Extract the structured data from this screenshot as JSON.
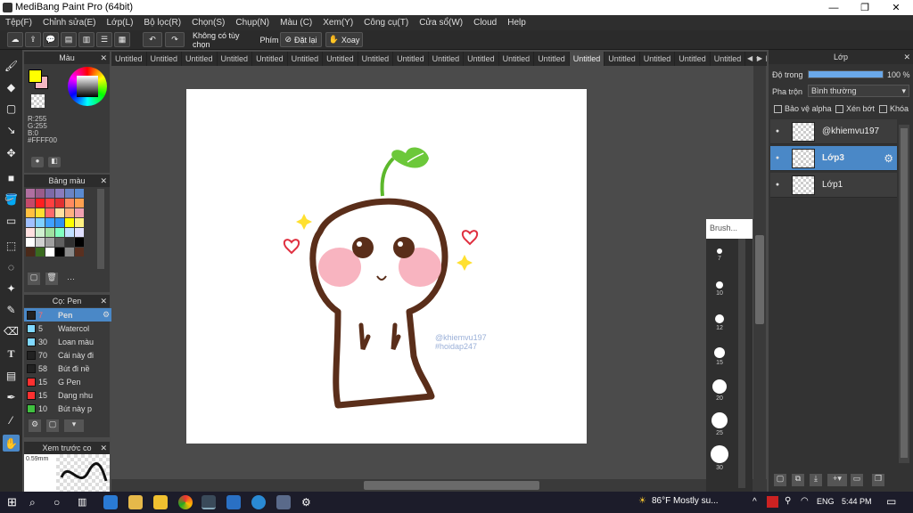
{
  "app": {
    "title": "MediBang Paint Pro (64bit)"
  },
  "window_controls": {
    "minimize": "—",
    "maximize": "❐",
    "close": "✕"
  },
  "menu": [
    "Tệp(F)",
    "Chỉnh sửa(E)",
    "Lớp(L)",
    "Bộ lọc(R)",
    "Chọn(S)",
    "Chụp(N)",
    "Màu (C)",
    "Xem(Y)",
    "Công cụ(T)",
    "Cửa sổ(W)",
    "Cloud",
    "Help"
  ],
  "toolbar": {
    "selection_label": "Không có tùy chọn",
    "keys_label": "Phím",
    "reset_label": "Đặt lại",
    "rotate_label": "Xoay"
  },
  "color_panel": {
    "title": "Màu",
    "r": "R:255",
    "g": "G:255",
    "b": "B:0",
    "hex": "#FFFF00",
    "primary": "#FFFF00",
    "secondary": "#F4B6C2"
  },
  "palette_panel": {
    "title": "Bảng màu",
    "more": "···",
    "colors": [
      "#b06fa0",
      "#9a5c8a",
      "#7d6aa8",
      "#8a7cbd",
      "#6a84c4",
      "#5a8ad0",
      "#c44a6a",
      "#ff2020",
      "#ff4040",
      "#e03030",
      "#ff8a60",
      "#ffa050",
      "#ffc040",
      "#ffe030",
      "#ff6a6a",
      "#ffe0a0",
      "#ffb080",
      "#f0a0b0",
      "#a0c0ff",
      "#80d0ff",
      "#40a0ff",
      "#3090f0",
      "#ffff00",
      "#fff080",
      "#ffe0e0",
      "#d0f0d0",
      "#a0e0a0",
      "#80ffc0",
      "#c0e0ff",
      "#e0e0ff",
      "#ffffff",
      "#d0d0d0",
      "#a0a0a0",
      "#606060",
      "#303030",
      "#000000",
      "#4a2a1a",
      "#3a6a20",
      "#ffffff",
      "#000000",
      "#8a8a8a",
      "#5a3020"
    ]
  },
  "brush_panel": {
    "title": "Cọ: Pen",
    "items": [
      {
        "size": "7",
        "name": "Pen",
        "color": "#222222",
        "selected": true
      },
      {
        "size": "5",
        "name": "Watercol",
        "color": "#80d8ff"
      },
      {
        "size": "30",
        "name": "Loan màu",
        "color": "#80d8ff"
      },
      {
        "size": "70",
        "name": "Cái này đi",
        "color": "#222222"
      },
      {
        "size": "58",
        "name": "Bút đi nề",
        "color": "#222222"
      },
      {
        "size": "15",
        "name": "G Pen",
        "color": "#ff3030"
      },
      {
        "size": "15",
        "name": "Dạng nhu",
        "color": "#ff3030"
      },
      {
        "size": "10",
        "name": "Bút này p",
        "color": "#40c040"
      }
    ]
  },
  "preview_panel": {
    "title": "Xem trước co",
    "size": "0.59mm"
  },
  "tabs": {
    "items": [
      "Untitled",
      "Untitled",
      "Untitled",
      "Untitled",
      "Untitled",
      "Untitled",
      "Untitled",
      "Untitled",
      "Untitled",
      "Untitled",
      "Untitled",
      "Untitled",
      "Untitled",
      "Untitled",
      "Untitled",
      "Untitled",
      "Untitled",
      "Untitled",
      "Untitled",
      "Untitled"
    ],
    "active_index": 13
  },
  "brush_size": {
    "title": "Brush...",
    "sizes": [
      "7",
      "10",
      "12",
      "15",
      "20",
      "25",
      "30"
    ]
  },
  "layer_panel": {
    "title": "Lớp",
    "opacity_label": "Độ trong",
    "opacity_value": "100 %",
    "opacity": 1.0,
    "blend_label": "Pha trộn",
    "blend_value": "Bình thường",
    "protect_alpha": "Bảo vệ alpha",
    "clipping": "Xén bớt",
    "lock": "Khóa",
    "layers": [
      {
        "name": "@khiemvu197",
        "selected": false
      },
      {
        "name": "Lớp3",
        "selected": true
      },
      {
        "name": "Lớp1",
        "selected": false
      }
    ]
  },
  "canvas": {
    "watermark1": "@khiemvu197",
    "watermark2": "#hoidap247"
  },
  "taskbar": {
    "weather": "86°F  Mostly su...",
    "lang": "ENG",
    "time": "5:44 PM"
  },
  "colors": {
    "accent": "#4a88c7",
    "bg": "#4a4a4a"
  }
}
